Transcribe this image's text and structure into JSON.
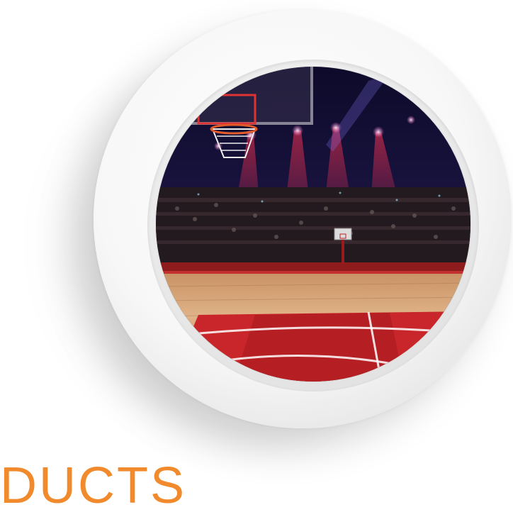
{
  "title": {
    "text": "DUCTS"
  },
  "colors": {
    "accent": "#f08a2c"
  },
  "image": {
    "subject": "basketball-arena-photo"
  }
}
